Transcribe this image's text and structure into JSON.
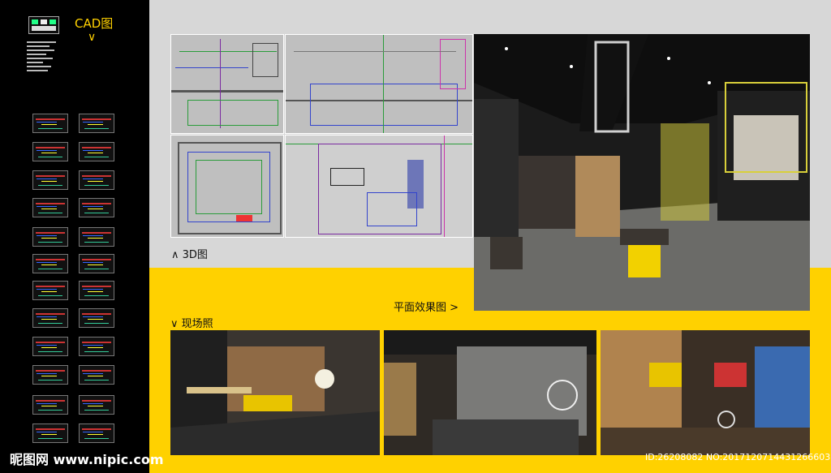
{
  "cad_column": {
    "title": "CAD图",
    "chevron": "∨"
  },
  "top_section": {
    "caption_3d": "∧ 3D图",
    "caption_render": "平面效果图 >"
  },
  "bottom_section": {
    "caption_photos": "∨ 现场照"
  },
  "watermark": {
    "logo": "昵图网 www.nipic.com",
    "id": "ID:26208082 NO:20171207144312666036"
  },
  "colors": {
    "accent_yellow": "#ffd100",
    "panel_gray": "#d7d7d7",
    "sidebar_black": "#000000"
  }
}
